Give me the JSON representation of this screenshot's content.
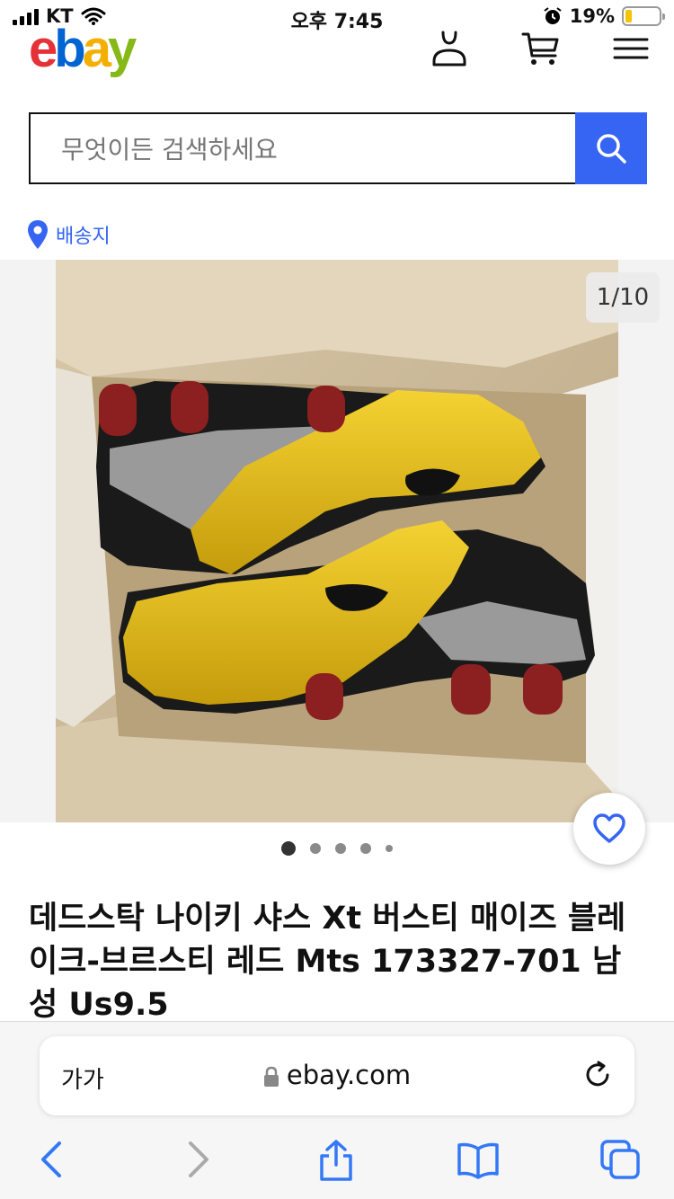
{
  "status_bar": {
    "carrier": "KT",
    "time": "오후 7:45",
    "battery": "19%",
    "battery_level": 0.19
  },
  "header": {
    "logo": [
      "e",
      "b",
      "a",
      "y"
    ],
    "icons": [
      "user-icon",
      "cart-icon",
      "menu-icon"
    ]
  },
  "search": {
    "placeholder": "무엇이든 검색하세요"
  },
  "location": {
    "label": "배송지"
  },
  "gallery": {
    "counter": "1/10",
    "dots": 5,
    "active_dot": 0
  },
  "product": {
    "title": "데드스탁 나이키 샤스 Xt 버스티 매이즈 블레이크-브르스티 레드 Mts 173327-701 남성 Us9.5"
  },
  "browser": {
    "text_size_label": "가가",
    "url": "ebay.com"
  },
  "colors": {
    "accent": "#3665f3",
    "battery": "#f5c400"
  }
}
